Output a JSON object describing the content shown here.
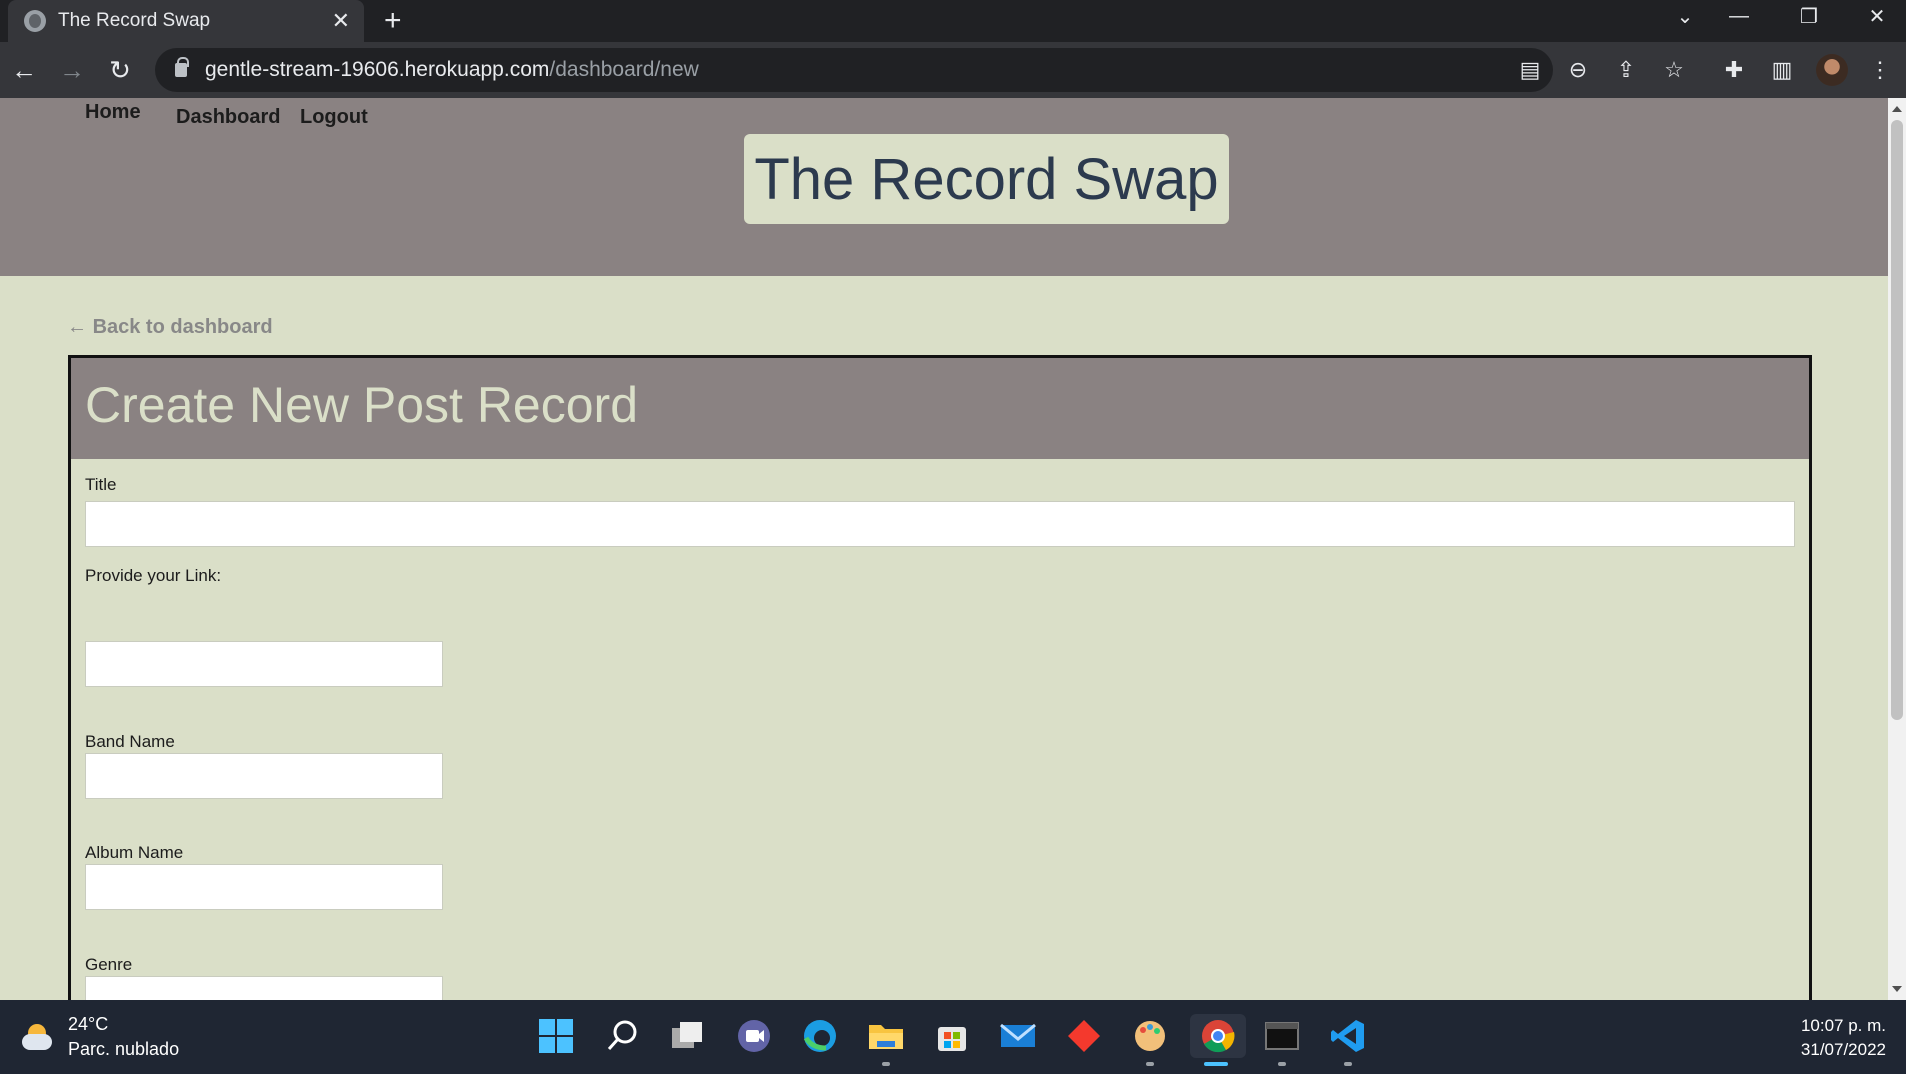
{
  "browser": {
    "tab_title": "The Record Swap",
    "url_host": "gentle-stream-19606.herokuapp.com",
    "url_path": "/dashboard/new"
  },
  "site": {
    "nav": {
      "home": "Home",
      "dashboard": "Dashboard",
      "logout": "Logout"
    },
    "brand": "The Record Swap",
    "back_link": "Back to dashboard",
    "back_arrow": "←"
  },
  "form": {
    "heading": "Create New Post Record",
    "fields": {
      "title": {
        "label": "Title",
        "value": ""
      },
      "link": {
        "label": "Provide your Link:",
        "value": ""
      },
      "band": {
        "label": "Band Name",
        "value": ""
      },
      "album": {
        "label": "Album Name",
        "value": ""
      },
      "genre": {
        "label": "Genre",
        "value": ""
      }
    }
  },
  "taskbar": {
    "weather_temp": "24°C",
    "weather_desc": "Parc. nublado",
    "time": "10:07 p. m.",
    "date": "31/07/2022"
  },
  "colors": {
    "header_bg": "#8a8282",
    "page_bg": "#dadfc8",
    "brand_text": "#2c3a4e"
  }
}
